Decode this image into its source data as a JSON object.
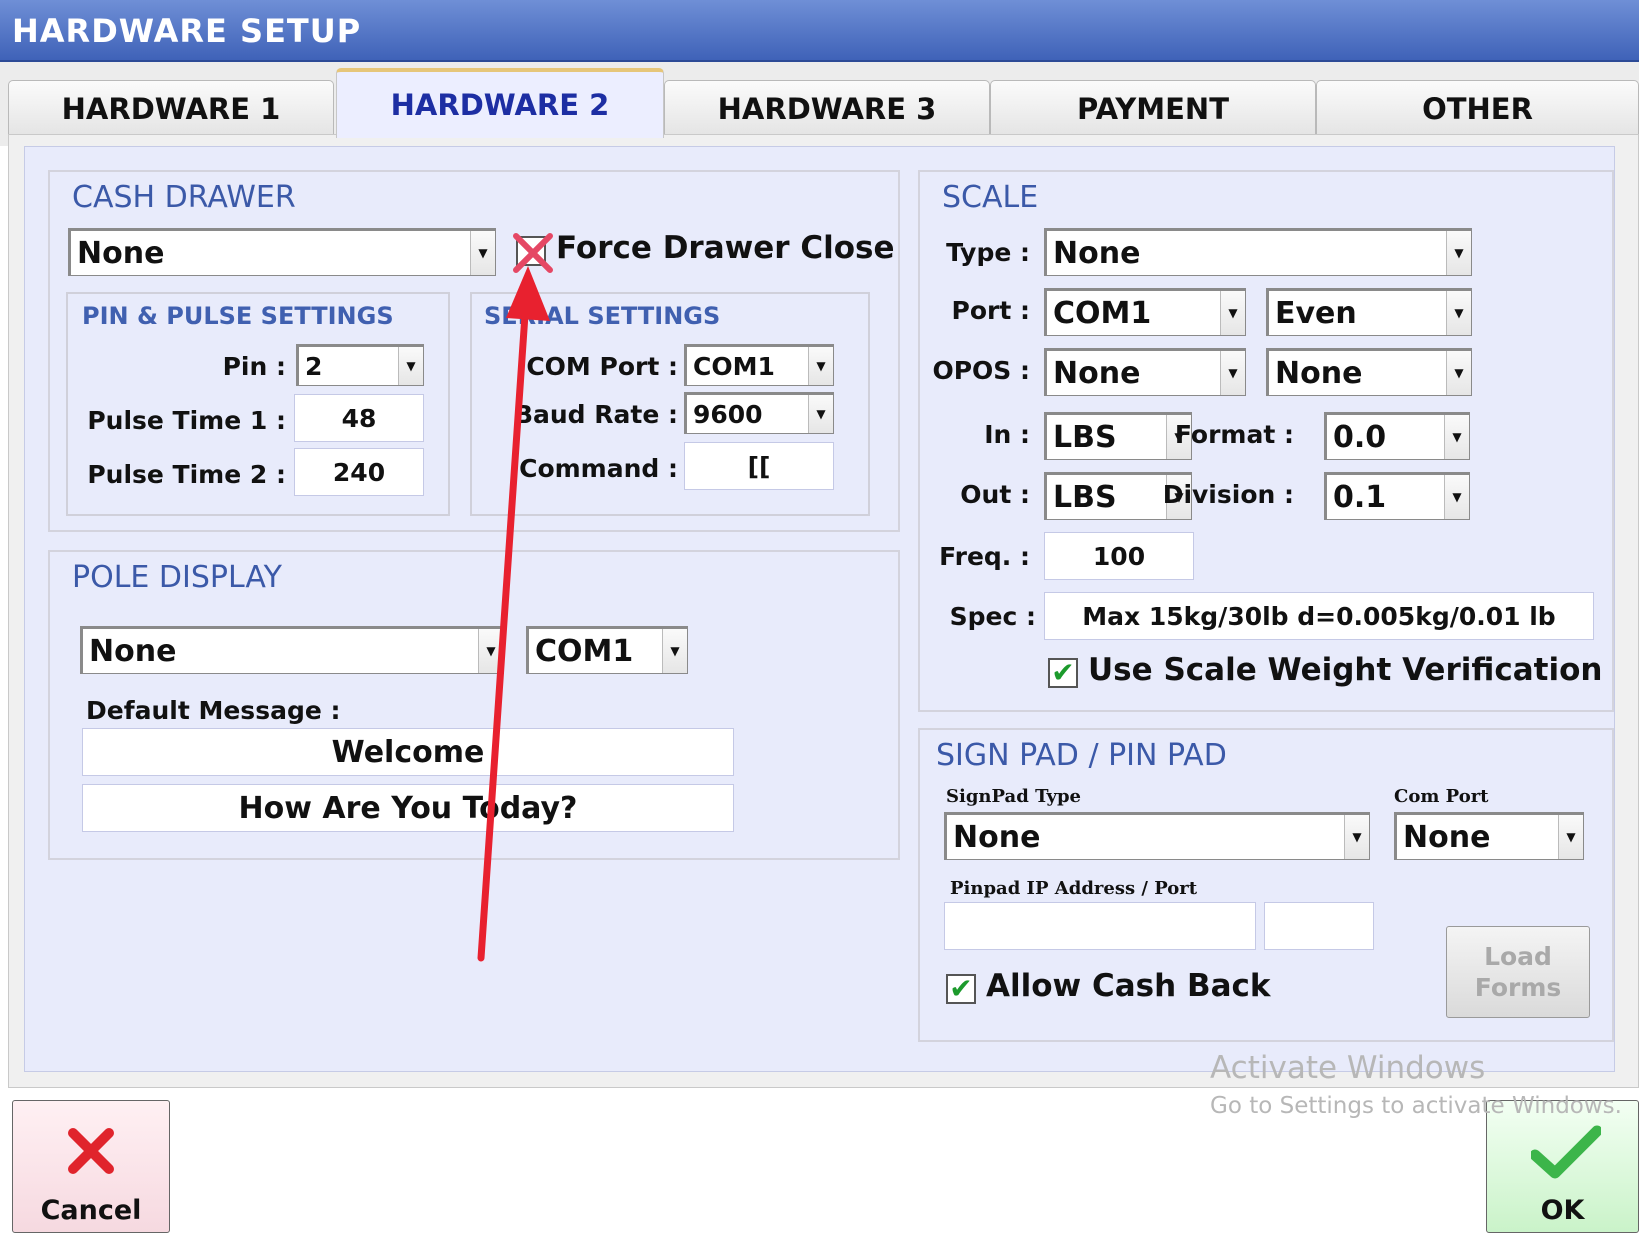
{
  "window": {
    "title": "HARDWARE SETUP"
  },
  "tabs": [
    {
      "label": "HARDWARE 1"
    },
    {
      "label": "HARDWARE 2"
    },
    {
      "label": "HARDWARE 3"
    },
    {
      "label": "PAYMENT"
    },
    {
      "label": "OTHER"
    }
  ],
  "active_tab": "HARDWARE 2",
  "cash_drawer": {
    "title": "CASH DRAWER",
    "type_value": "None",
    "force_drawer_close_label": "Force Drawer Close",
    "force_drawer_close_checked": false,
    "pin_pulse": {
      "title": "PIN & PULSE SETTINGS",
      "pin_label": "Pin :",
      "pin_value": "2",
      "pulse1_label": "Pulse Time 1 :",
      "pulse1_value": "48",
      "pulse2_label": "Pulse Time 2 :",
      "pulse2_value": "240"
    },
    "serial": {
      "title": "SERIAL SETTINGS",
      "com_port_label": "COM Port :",
      "com_port_value": "COM1",
      "baud_rate_label": "Baud Rate :",
      "baud_rate_value": "9600",
      "command_label": "Command :",
      "command_value": "[["
    }
  },
  "pole_display": {
    "title": "POLE DISPLAY",
    "type_value": "None",
    "port_value": "COM1",
    "default_message_label": "Default Message :",
    "line1": "Welcome",
    "line2": "How Are You Today?"
  },
  "scale": {
    "title": "SCALE",
    "type_label": "Type :",
    "type_value": "None",
    "port_label": "Port :",
    "port_value": "COM1",
    "parity_value": "Even",
    "opos_label": "OPOS :",
    "opos_value": "None",
    "opos_value2": "None",
    "in_label": "In :",
    "in_value": "LBS",
    "format_label": "Format :",
    "format_value": "0.0",
    "out_label": "Out :",
    "out_value": "LBS",
    "division_label": "Division :",
    "division_value": "0.1",
    "freq_label": "Freq. :",
    "freq_value": "100",
    "spec_label": "Spec :",
    "spec_value": "Max 15kg/30lb d=0.005kg/0.01 lb",
    "weight_verification_label": "Use Scale Weight Verification",
    "weight_verification_checked": true
  },
  "sign_pad": {
    "title": "SIGN PAD / PIN PAD",
    "signpad_type_label": "SignPad Type",
    "signpad_type_value": "None",
    "com_port_label": "Com Port",
    "com_port_value": "None",
    "pinpad_ip_label": "Pinpad IP Address / Port",
    "pinpad_ip_value": "",
    "pinpad_port_value": "",
    "allow_cash_back_label": "Allow Cash Back",
    "allow_cash_back_checked": true,
    "load_forms_line1": "Load",
    "load_forms_line2": "Forms"
  },
  "footer": {
    "cancel_label": "Cancel",
    "ok_label": "OK"
  },
  "watermark": {
    "line1": "Activate Windows",
    "line2": "Go to Settings to activate Windows."
  },
  "colors": {
    "title_bar": "#4a6cc4",
    "panel_bg": "#e8ebfb",
    "group_title": "#3b59a8",
    "active_tab_text": "#1d2ea3",
    "check_green": "#1c9a2c",
    "annotation_red": "#e8212f"
  }
}
